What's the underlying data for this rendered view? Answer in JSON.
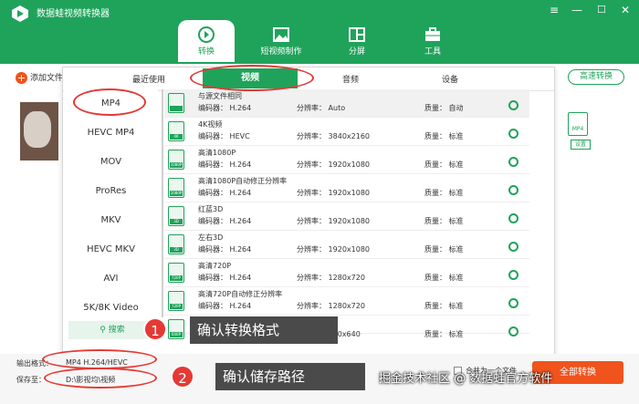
{
  "app": {
    "title": "数据蛙视频转换器",
    "window_controls": [
      "≡",
      "—",
      "☐",
      "✕"
    ]
  },
  "nav": {
    "tabs": [
      {
        "label": "转换",
        "active": true
      },
      {
        "label": "短视频制作",
        "active": false
      },
      {
        "label": "分屏",
        "active": false
      },
      {
        "label": "工具",
        "active": false
      }
    ]
  },
  "toolbar": {
    "add_file": "添加文件",
    "fast_convert": "高速转换",
    "side_format": "MP4",
    "side_settings": "设置"
  },
  "panel": {
    "tabs": [
      "最近使用",
      "视频",
      "音频",
      "设备"
    ],
    "active_tab": "视频",
    "categories": [
      "MP4",
      "HEVC MP4",
      "MOV",
      "ProRes",
      "MKV",
      "HEVC MKV",
      "AVI",
      "5K/8K Video"
    ],
    "selected_category": "MP4",
    "search": "搜索",
    "formats": [
      {
        "name": "与源文件相同",
        "encoder_label": "编码器：",
        "encoder": "H.264",
        "res_label": "分辨率：",
        "res": "Auto",
        "q_label": "质量：",
        "quality": "自动",
        "tag": ""
      },
      {
        "name": "4K视频",
        "encoder_label": "编码器：",
        "encoder": "HEVC",
        "res_label": "分辨率：",
        "res": "3840x2160",
        "q_label": "质量：",
        "quality": "标准",
        "tag": "4K"
      },
      {
        "name": "高清1080P",
        "encoder_label": "编码器：",
        "encoder": "H.264",
        "res_label": "分辨率：",
        "res": "1920x1080",
        "q_label": "质量：",
        "quality": "标准",
        "tag": "1080P"
      },
      {
        "name": "高清1080P自动修正分辨率",
        "encoder_label": "编码器：",
        "encoder": "H.264",
        "res_label": "分辨率：",
        "res": "1920x1080",
        "q_label": "质量：",
        "quality": "标准",
        "tag": "1080P"
      },
      {
        "name": "红蓝3D",
        "encoder_label": "编码器：",
        "encoder": "H.264",
        "res_label": "分辨率：",
        "res": "1920x1080",
        "q_label": "质量：",
        "quality": "标准",
        "tag": "3D"
      },
      {
        "name": "左右3D",
        "encoder_label": "编码器：",
        "encoder": "H.264",
        "res_label": "分辨率：",
        "res": "1920x1080",
        "q_label": "质量：",
        "quality": "标准",
        "tag": "3D"
      },
      {
        "name": "高清720P",
        "encoder_label": "编码器：",
        "encoder": "H.264",
        "res_label": "分辨率：",
        "res": "1280x720",
        "q_label": "质量：",
        "quality": "标准",
        "tag": "720P"
      },
      {
        "name": "高清720P自动修正分辨率",
        "encoder_label": "编码器：",
        "encoder": "H.264",
        "res_label": "分辨率：",
        "res": "1280x720",
        "q_label": "质量：",
        "quality": "标准",
        "tag": "720P"
      },
      {
        "name": "",
        "encoder_label": "编码器：",
        "encoder": "",
        "res_label": "分辨率：",
        "res": "960x640",
        "q_label": "质量：",
        "quality": "标准",
        "tag": "640P"
      }
    ]
  },
  "bottom": {
    "output_label": "输出格式：",
    "output_value": "MP4 H.264/HEVC",
    "save_label": "保存至：",
    "save_value": "D:\\影视均\\视频",
    "merge_label": "合并为一个文件",
    "convert_all": "全部转换"
  },
  "callouts": [
    {
      "num": "1",
      "text": "确认转换格式"
    },
    {
      "num": "2",
      "text": "确认储存路径"
    }
  ],
  "watermark": "掘金技术社区 @ 数据蛙官方软件",
  "colors": {
    "brand_green": "#1fa35b",
    "accent_orange": "#f0531c",
    "highlight_red": "#e53935"
  }
}
